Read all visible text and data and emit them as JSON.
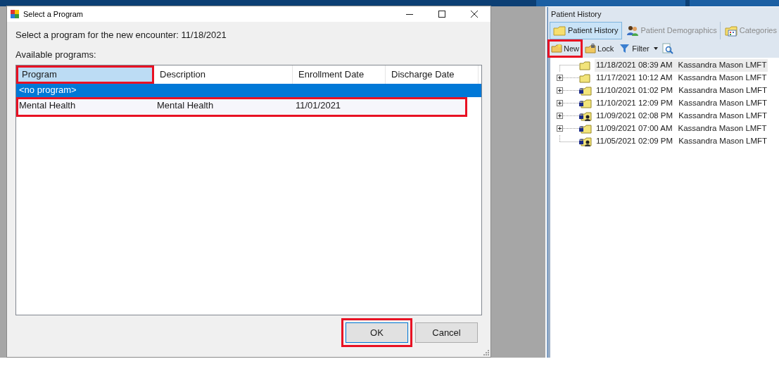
{
  "dialog": {
    "title": "Select a Program",
    "prompt": "Select a program for the new encounter: 11/18/2021",
    "list_label": "Available programs:",
    "columns": [
      {
        "label": "Program",
        "highlighted": true
      },
      {
        "label": "Description",
        "highlighted": false
      },
      {
        "label": "Enrollment Date",
        "highlighted": false
      },
      {
        "label": "Discharge Date",
        "highlighted": false
      }
    ],
    "rows": [
      {
        "cells": [
          "<no program>"
        ],
        "selected": true,
        "highlighted": false
      },
      {
        "cells": [
          "Mental Health",
          "Mental Health",
          "11/01/2021"
        ],
        "selected": false,
        "highlighted": true
      }
    ],
    "buttons": [
      {
        "label": "OK",
        "highlighted": true,
        "default": true
      },
      {
        "label": "Cancel",
        "highlighted": false,
        "default": false
      }
    ]
  },
  "panel": {
    "title": "Patient History",
    "tabs": [
      {
        "label": "Patient History",
        "selected": true,
        "kind": "folder"
      },
      {
        "label": "Patient Demographics",
        "selected": false,
        "kind": "people"
      },
      {
        "label": "Categories",
        "selected": false,
        "kind": "calendar"
      }
    ],
    "toolbar": [
      {
        "label": "New",
        "kind": "new",
        "highlighted": true
      },
      {
        "label": "Lock",
        "kind": "lock",
        "highlighted": false
      },
      {
        "label": "Filter",
        "kind": "filter",
        "highlighted": false
      },
      {
        "kind": "preview",
        "highlighted": false
      }
    ],
    "tree": [
      {
        "date": "11/18/2021 08:39 AM",
        "author": "Kassandra Mason LMFT",
        "expandable": false,
        "kind": "folder",
        "selected": true
      },
      {
        "date": "11/17/2021 10:12 AM",
        "author": "Kassandra Mason LMFT",
        "expandable": true,
        "kind": "folder",
        "selected": false
      },
      {
        "date": "11/10/2021 01:02 PM",
        "author": "Kassandra Mason LMFT",
        "expandable": true,
        "kind": "locked",
        "selected": false
      },
      {
        "date": "11/10/2021 12:09 PM",
        "author": "Kassandra Mason LMFT",
        "expandable": true,
        "kind": "locked",
        "selected": false
      },
      {
        "date": "11/09/2021 02:08 PM",
        "author": "Kassandra Mason LMFT",
        "expandable": true,
        "kind": "locked-user",
        "selected": false
      },
      {
        "date": "11/09/2021 07:00 AM",
        "author": "Kassandra Mason LMFT",
        "expandable": true,
        "kind": "locked",
        "selected": false
      },
      {
        "date": "11/05/2021 02:09 PM",
        "author": "Kassandra Mason LMFT",
        "expandable": false,
        "kind": "locked-user",
        "selected": false
      }
    ]
  }
}
